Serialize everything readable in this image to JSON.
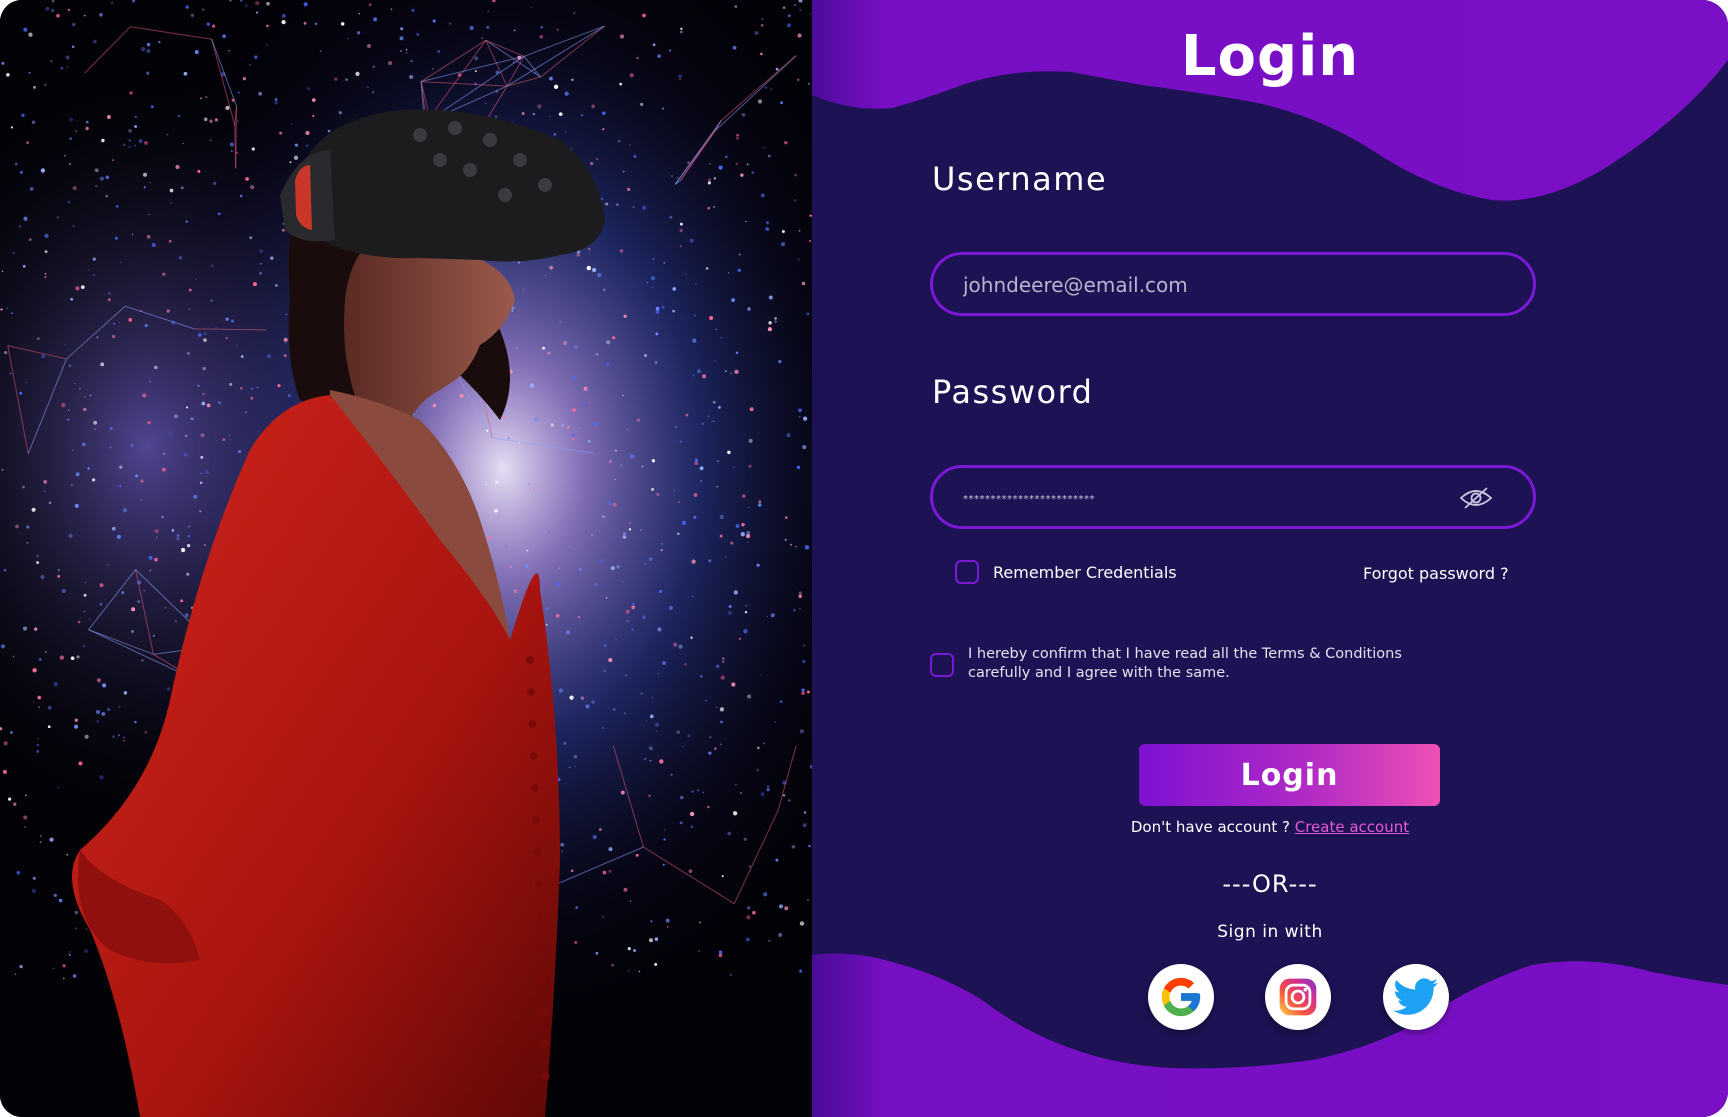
{
  "colors": {
    "panel_bg": "#1d1254",
    "wave_purple": "#7a0fc6",
    "accent_border": "#7a19d6",
    "link_pink": "#e25ad4",
    "button_gradient_start": "#7e11d2",
    "button_gradient_end": "#ee4fb5"
  },
  "header": {
    "title": "Login"
  },
  "username": {
    "label": "Username",
    "placeholder": "johndeere@email.com"
  },
  "password": {
    "label": "Password",
    "masked_value": "************************",
    "toggle_icon": "eye-slash-icon"
  },
  "options": {
    "remember_label": "Remember Credentials",
    "forgot_label": "Forgot password ?",
    "terms_text": "I hereby confirm that I have read all the Terms & Conditions carefully and I agree with the same."
  },
  "actions": {
    "login_label": "Login",
    "no_account_text": "Don't have account ?",
    "create_account_label": "Create account"
  },
  "social": {
    "separator": "---OR---",
    "sign_in_with": "Sign in with",
    "providers": [
      {
        "name": "Google",
        "icon": "google-icon"
      },
      {
        "name": "Instagram",
        "icon": "instagram-icon"
      },
      {
        "name": "Twitter",
        "icon": "twitter-icon"
      }
    ]
  },
  "photo": {
    "description_icon": "vr-headset-icon"
  }
}
